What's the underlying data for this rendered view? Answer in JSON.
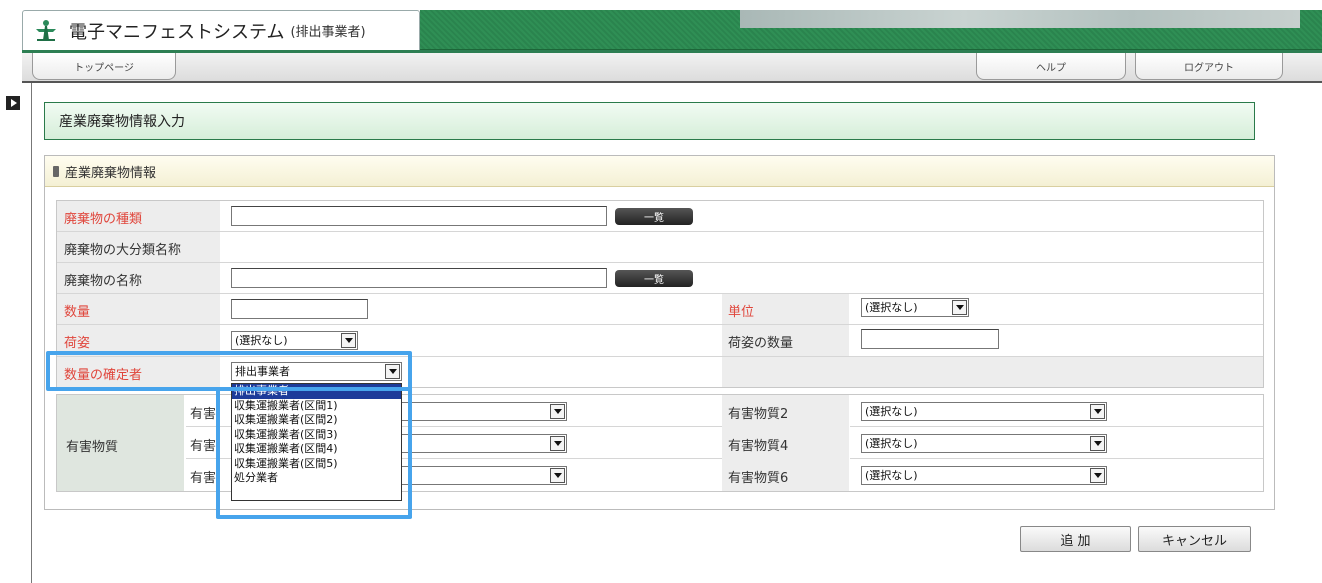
{
  "header": {
    "app_title": "電子マニフェストシステム",
    "app_subtitle": "(排出事業者)"
  },
  "nav": {
    "top_page": "トップページ",
    "help": "ヘルプ",
    "logout": "ログアウト"
  },
  "page": {
    "title": "産業廃棄物情報入力",
    "section_title": "産業廃棄物情報"
  },
  "form": {
    "waste_type_label": "廃棄物の種類",
    "waste_major_label": "廃棄物の大分類名称",
    "waste_name_label": "廃棄物の名称",
    "list_button": "一覧",
    "quantity_label": "数量",
    "unit_label": "単位",
    "unit_value": "(選択なし)",
    "packing_label": "荷姿",
    "packing_value": "(選択なし)",
    "packing_qty_label": "荷姿の数量",
    "confirmer_label": "数量の確定者",
    "confirmer_value": "排出事業者",
    "confirmer_options": [
      "排出事業者",
      "収集運搬業者(区間1)",
      "収集運搬業者(区間2)",
      "収集運搬業者(区間3)",
      "収集運搬業者(区間4)",
      "収集運搬業者(区間5)",
      "処分業者"
    ],
    "hazard_group_label": "有害物質",
    "hazard_label_partial": "有害",
    "hazard2_label": "有害物質2",
    "hazard4_label": "有害物質4",
    "hazard6_label": "有害物質6",
    "hazard_none": "(選択なし)"
  },
  "actions": {
    "add": "追 加",
    "cancel": "キャンセル"
  },
  "colors": {
    "brand_green": "#2f8f55",
    "required_red": "#e0463c",
    "highlight_blue": "#47a4ec",
    "selected_option": "#1d3b9a"
  }
}
